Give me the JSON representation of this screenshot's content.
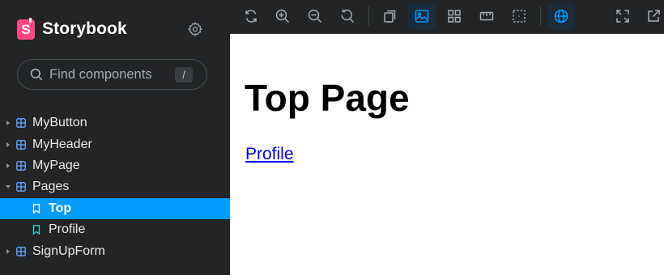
{
  "sidebar": {
    "brand": {
      "name": "Storybook",
      "logo_letter": "S"
    },
    "settings_icon": "gear-icon",
    "search": {
      "placeholder": "Find components",
      "shortcut": "/"
    },
    "tree": [
      {
        "type": "component",
        "label": "MyButton",
        "expanded": false
      },
      {
        "type": "component",
        "label": "MyHeader",
        "expanded": false
      },
      {
        "type": "component",
        "label": "MyPage",
        "expanded": false
      },
      {
        "type": "component",
        "label": "Pages",
        "expanded": true
      },
      {
        "type": "story",
        "label": "Top",
        "selected": true
      },
      {
        "type": "story",
        "label": "Profile",
        "selected": false
      },
      {
        "type": "component",
        "label": "SignUpForm",
        "expanded": false
      }
    ]
  },
  "toolbar": {
    "buttons": [
      {
        "icon": "sync-icon",
        "active": false
      },
      {
        "icon": "zoom-in-icon",
        "active": false
      },
      {
        "icon": "zoom-out-icon",
        "active": false
      },
      {
        "icon": "zoom-reset-icon",
        "active": false
      },
      {
        "icon": "copy-icon",
        "active": false
      },
      {
        "icon": "image-icon",
        "active": true
      },
      {
        "icon": "grid-icon",
        "active": false
      },
      {
        "icon": "ruler-icon",
        "active": false
      },
      {
        "icon": "outline-icon",
        "active": false
      },
      {
        "icon": "globe-icon",
        "active": true
      },
      {
        "icon": "fullscreen-icon",
        "active": false
      },
      {
        "icon": "share-icon",
        "active": false
      }
    ]
  },
  "preview": {
    "heading": "Top Page",
    "link": "Profile"
  },
  "colors": {
    "sidebar_bg": "#222425",
    "accent": "#029cfd",
    "brand": "#ff4785",
    "link": "#0000ee"
  }
}
